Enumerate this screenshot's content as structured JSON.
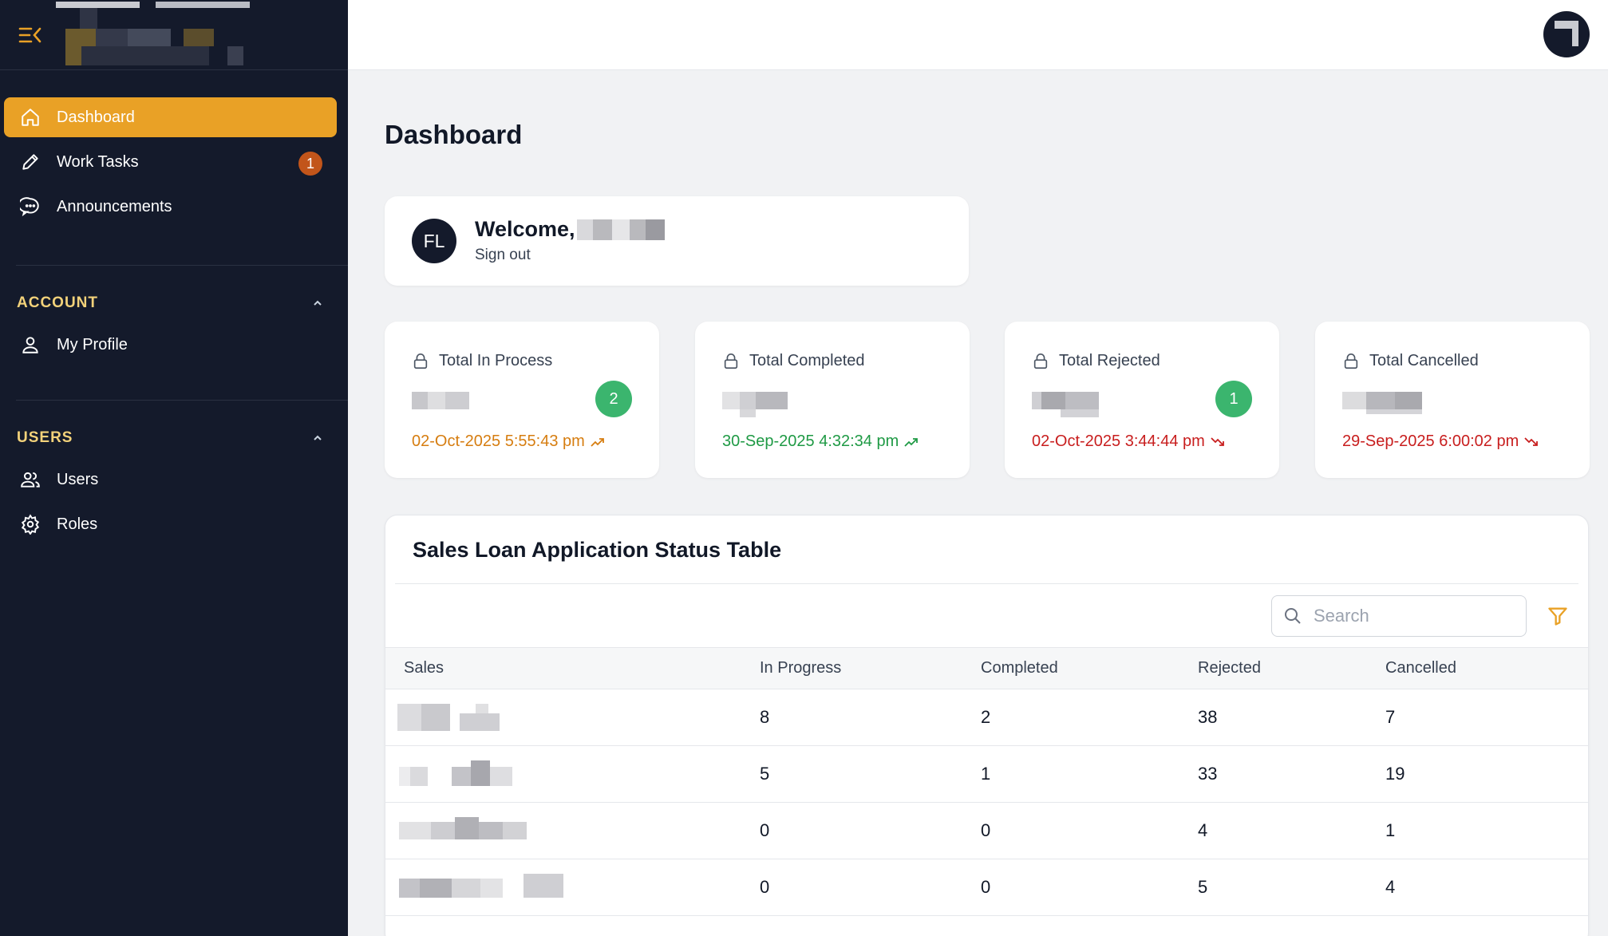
{
  "sidebar": {
    "nav": [
      {
        "label": "Dashboard",
        "icon": "home-icon",
        "active": true
      },
      {
        "label": "Work Tasks",
        "icon": "pencil-icon",
        "badge": "1"
      },
      {
        "label": "Announcements",
        "icon": "chat-bubble-icon"
      }
    ],
    "sections": [
      {
        "title": "ACCOUNT",
        "items": [
          {
            "label": "My Profile",
            "icon": "user-icon"
          }
        ]
      },
      {
        "title": "USERS",
        "items": [
          {
            "label": "Users",
            "icon": "users-icon"
          },
          {
            "label": "Roles",
            "icon": "gear-icon"
          }
        ]
      }
    ]
  },
  "page": {
    "title": "Dashboard"
  },
  "welcome": {
    "greeting": "Welcome,",
    "initials": "FL",
    "signout": "Sign out"
  },
  "stats": [
    {
      "label": "Total In Process",
      "count": "2",
      "date": "02-Oct-2025 5:55:43 pm",
      "trend": "up",
      "color": "#d67d10"
    },
    {
      "label": "Total Completed",
      "count": "",
      "date": "30-Sep-2025 4:32:34 pm",
      "trend": "up",
      "color": "#1f9a45"
    },
    {
      "label": "Total Rejected",
      "count": "1",
      "date": "02-Oct-2025 3:44:44 pm",
      "trend": "down",
      "color": "#c81e1e"
    },
    {
      "label": "Total Cancelled",
      "count": "",
      "date": "29-Sep-2025 6:00:02 pm",
      "trend": "down",
      "color": "#c81e1e"
    }
  ],
  "table": {
    "title": "Sales Loan Application Status Table",
    "search_placeholder": "Search",
    "columns": [
      "Sales",
      "In Progress",
      "Completed",
      "Rejected",
      "Cancelled"
    ],
    "rows": [
      {
        "in_progress": "8",
        "completed": "2",
        "rejected": "38",
        "cancelled": "7"
      },
      {
        "in_progress": "5",
        "completed": "1",
        "rejected": "33",
        "cancelled": "19"
      },
      {
        "in_progress": "0",
        "completed": "0",
        "rejected": "4",
        "cancelled": "1"
      },
      {
        "in_progress": "0",
        "completed": "0",
        "rejected": "5",
        "cancelled": "4"
      }
    ]
  },
  "colors": {
    "accent": "#e9a126",
    "sidebar_bg": "#141a2b",
    "section_title": "#f3d27a",
    "badge": "#c2551a",
    "count_badge": "#3bb56e"
  }
}
